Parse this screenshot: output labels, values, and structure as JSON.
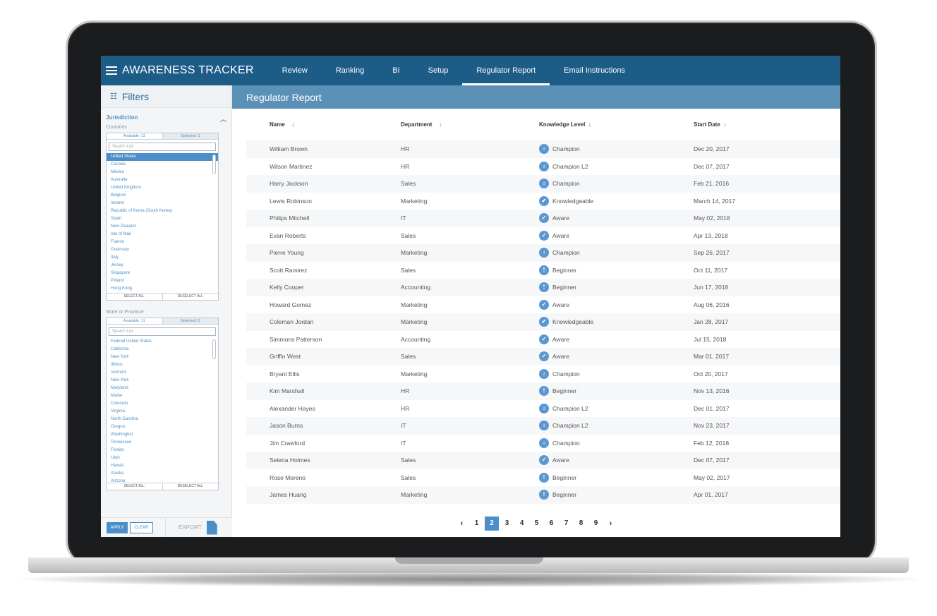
{
  "app": {
    "title": "AWARENESS TRACKER"
  },
  "nav": [
    {
      "label": "Review",
      "active": false
    },
    {
      "label": "Ranking",
      "active": false
    },
    {
      "label": "BI",
      "active": false
    },
    {
      "label": "Setup",
      "active": false
    },
    {
      "label": "Regulator Report",
      "active": true
    },
    {
      "label": "Email Instructions",
      "active": false
    }
  ],
  "sidebar": {
    "title": "Filters",
    "jurisdiction": {
      "title": "Jurisdiction",
      "subtitle": "Countries",
      "available": "Available: 11",
      "selected": "Selected: 1",
      "search_placeholder": "Search List",
      "items": [
        "United States",
        "Canada",
        "Mexico",
        "Australia",
        "United Kingdom",
        "Belgium",
        "Ireland",
        "Republic of Korea (South Korea)",
        "Spain",
        "New Zealand",
        "Isle of Man",
        "France",
        "Guernsey",
        "Italy",
        "Jersey",
        "Singapore",
        "Poland",
        "Hong Kong"
      ],
      "select_all": "SELECT ALL",
      "deselect_all": "DESELECT ALL"
    },
    "state": {
      "subtitle": "State or Province",
      "available": "Available: 11",
      "selected": "Selected: 0",
      "search_placeholder": "Search List",
      "items": [
        "Federal United States",
        "California",
        "New York",
        "Illinois",
        "Vermont",
        "New York",
        "Maryland",
        "Maine",
        "Colorado",
        "Virginia",
        "North Carolina",
        "Oregon",
        "Washington",
        "Tennessee",
        "Florida",
        "Utah",
        "Hawaii",
        "Alaska",
        "Arizona"
      ],
      "select_all": "SELECT ALL",
      "deselect_all": "DESELECT ALL"
    },
    "apply": "APPLY",
    "clear": "CLEAR",
    "export": "EXPORT"
  },
  "report": {
    "title": "Regulator Report",
    "columns": [
      "Name",
      "Department",
      "Knowledge Level",
      "Start Date"
    ],
    "rows": [
      {
        "name": "William Brown",
        "dept": "HR",
        "level": "Champion",
        "icon": "award-icon",
        "date": "Dec 20, 2017"
      },
      {
        "name": "Wilson Martinez",
        "dept": "HR",
        "level": "Champion L2",
        "icon": "award-icon",
        "date": "Dec 07, 2017"
      },
      {
        "name": "Harry Jackson",
        "dept": "Sales",
        "level": "Champion",
        "icon": "award-icon",
        "date": "Feb 21, 2016"
      },
      {
        "name": "Lewis Robinson",
        "dept": "Marketing",
        "level": "Knowledgeable",
        "icon": "check-badge-icon",
        "date": "March 14, 2017"
      },
      {
        "name": "Philips Mitchell",
        "dept": "IT",
        "level": "Aware",
        "icon": "check-icon",
        "date": "May 02, 2018"
      },
      {
        "name": "Evan Roberts",
        "dept": "Sales",
        "level": "Aware",
        "icon": "check-icon",
        "date": "Apr 13, 2018"
      },
      {
        "name": "Pierre Young",
        "dept": "Marketing",
        "level": "Champion",
        "icon": "award-icon",
        "date": "Sep 26, 2017"
      },
      {
        "name": "Scott Ramirez",
        "dept": "Sales",
        "level": "Beginner",
        "icon": "exclamation-icon",
        "date": "Oct 11, 2017"
      },
      {
        "name": "Kelly Cooper",
        "dept": "Accounting",
        "level": "Beginner",
        "icon": "exclamation-icon",
        "date": "Jun 17, 2018"
      },
      {
        "name": "Howard Gomez",
        "dept": "Marketing",
        "level": "Aware",
        "icon": "check-icon",
        "date": "Aug 06, 2016"
      },
      {
        "name": "Coleman Jordan",
        "dept": "Marketing",
        "level": "Knowledgeable",
        "icon": "check-badge-icon",
        "date": "Jan 28, 2017"
      },
      {
        "name": "Simmons Patterson",
        "dept": "Accounting",
        "level": "Aware",
        "icon": "check-icon",
        "date": "Jul 15, 2018"
      },
      {
        "name": "Griffin West",
        "dept": "Sales",
        "level": "Aware",
        "icon": "check-icon",
        "date": "Mar 01, 2017"
      },
      {
        "name": "Bryant Ellis",
        "dept": "Marketing",
        "level": "Champion",
        "icon": "award-icon",
        "date": "Oct 20, 2017"
      },
      {
        "name": "Kim Marshall",
        "dept": "HR",
        "level": "Beginner",
        "icon": "exclamation-icon",
        "date": "Nov 13, 2016"
      },
      {
        "name": "Alexander Hayes",
        "dept": "HR",
        "level": "Champion L2",
        "icon": "award-icon",
        "date": "Dec 01, 2017"
      },
      {
        "name": "Jason Burns",
        "dept": "IT",
        "level": "Champion L2",
        "icon": "award-icon",
        "date": "Nov 23, 2017"
      },
      {
        "name": "Jim Crawford",
        "dept": "IT",
        "level": "Champion",
        "icon": "award-icon",
        "date": "Feb 12, 2018"
      },
      {
        "name": "Selena Holmes",
        "dept": "Sales",
        "level": "Aware",
        "icon": "check-icon",
        "date": "Dec 07, 2017"
      },
      {
        "name": "Rose Moreno",
        "dept": "Sales",
        "level": "Beginner",
        "icon": "exclamation-icon",
        "date": "May 02, 2017"
      },
      {
        "name": "James Huang",
        "dept": "Marketing",
        "level": "Beginner",
        "icon": "exclamation-icon",
        "date": "Apr 01, 2017"
      }
    ],
    "pages": [
      "1",
      "2",
      "3",
      "4",
      "5",
      "6",
      "7",
      "8",
      "9"
    ],
    "current_page": "2"
  },
  "colors": {
    "primary": "#1e5c88",
    "accent": "#4c8fc8",
    "subheader": "#5b90b7"
  }
}
